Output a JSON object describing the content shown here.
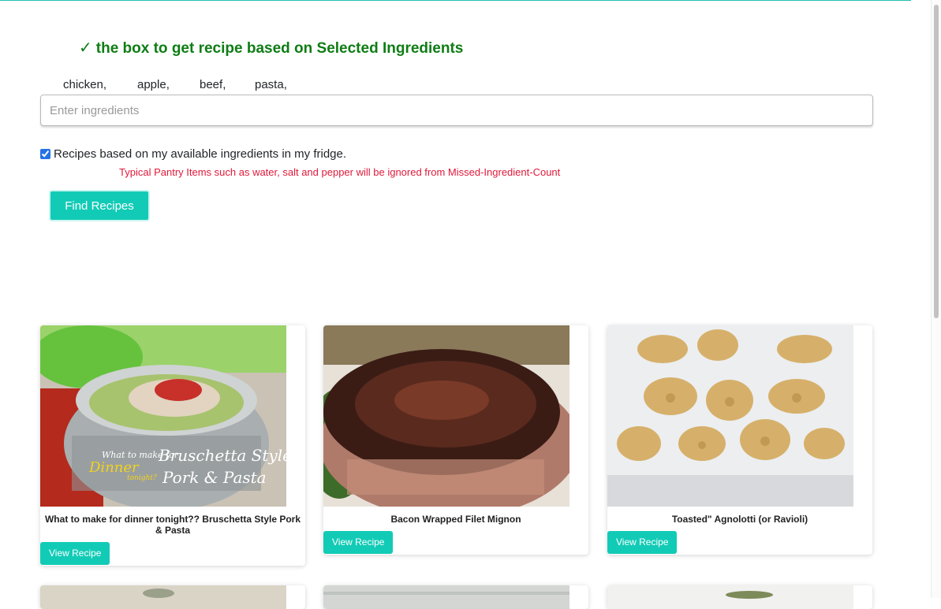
{
  "heading": {
    "check": "✓",
    "text": "the box to get recipe based on Selected Ingredients"
  },
  "ingredients_list": [
    "chicken,",
    "apple,",
    "beef,",
    "pasta,"
  ],
  "ingredients_input": {
    "placeholder": "Enter ingredients",
    "value": ""
  },
  "fridge_checkbox": {
    "label": "Recipes based on my available ingredients in my fridge.",
    "checked": true
  },
  "pantry_note": "Typical Pantry Items such as water, salt and pepper will be ignored from Missed-Ingredient-Count",
  "find_button": "Find Recipes",
  "recipes": [
    {
      "title": "What to make for dinner tonight?? Bruschetta Style Pork & Pasta",
      "button": "View Recipe",
      "image_caption_1": "What to make for",
      "image_caption_2": "Dinner",
      "image_caption_3": "tonight?",
      "image_caption_4": "Bruschetta Style",
      "image_caption_5": "Pork & Pasta"
    },
    {
      "title": "Bacon Wrapped Filet Mignon",
      "button": "View Recipe"
    },
    {
      "title": "Toasted\" Agnolotti (or Ravioli)",
      "button": "View Recipe"
    }
  ],
  "colors": {
    "accent": "#12cbb6",
    "heading": "#0e7d14",
    "warning": "#e0193a"
  }
}
